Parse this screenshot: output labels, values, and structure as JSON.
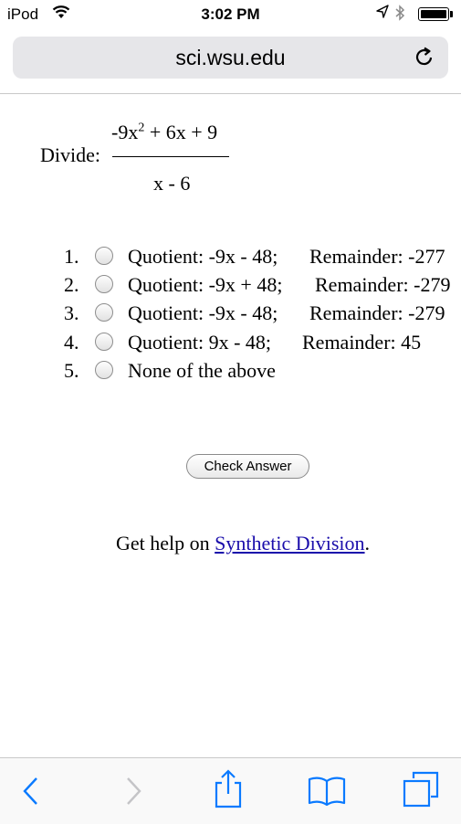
{
  "status_bar": {
    "carrier": "iPod",
    "time": "3:02 PM"
  },
  "browser": {
    "url": "sci.wsu.edu"
  },
  "problem": {
    "label": "Divide:",
    "numerator_base": "-9x",
    "numerator_exponent": "2",
    "numerator_rest": " + 6x + 9",
    "denominator": "x - 6"
  },
  "choices": [
    {
      "number": "1.",
      "quotient": "Quotient:  -9x - 48;",
      "remainder": "Remainder: -277"
    },
    {
      "number": "2.",
      "quotient": "Quotient:  -9x + 48;",
      "remainder": "Remainder: -279"
    },
    {
      "number": "3.",
      "quotient": "Quotient:  -9x - 48;",
      "remainder": "Remainder: -279"
    },
    {
      "number": "4.",
      "quotient": "Quotient:  9x - 48;",
      "remainder": "Remainder: 45"
    },
    {
      "number": "5.",
      "quotient": "None of the above",
      "remainder": ""
    }
  ],
  "check_button": "Check Answer",
  "help": {
    "prefix": "Get help on ",
    "link_text": "Synthetic Division",
    "suffix": "."
  },
  "icons": {
    "wifi": "wifi-icon",
    "location": "location-arrow-icon",
    "bluetooth": "bluetooth-icon",
    "battery": "battery-icon",
    "reload": "reload-icon",
    "back": "back-chevron-icon",
    "forward": "forward-chevron-icon",
    "share": "share-icon",
    "bookmarks": "bookmarks-icon",
    "tabs": "tabs-icon"
  },
  "colors": {
    "ios_blue": "#0a7aff",
    "link": "#1a0dab",
    "url_bar": "#e6e6e9"
  }
}
